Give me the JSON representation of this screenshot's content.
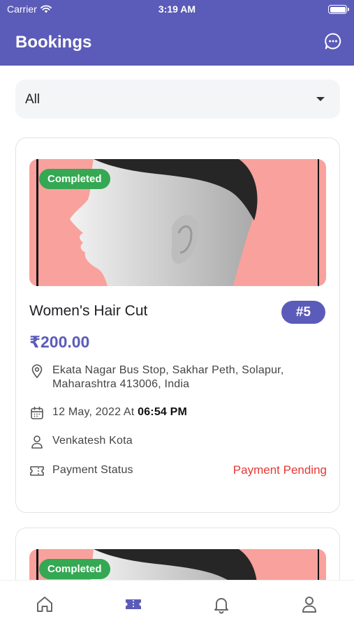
{
  "status_bar": {
    "carrier": "Carrier",
    "time": "3:19 AM"
  },
  "header": {
    "title": "Bookings",
    "chat_icon": "chat-bubble-icon"
  },
  "filter": {
    "selected": "All"
  },
  "bookings": [
    {
      "status": "Completed",
      "service": "Women's Hair Cut",
      "number": "#5",
      "price": "₹200.00",
      "address": "Ekata Nagar Bus Stop, Sakhar Peth, Solapur, Maharashtra 413006, India",
      "date": "12 May, 2022 At",
      "time": "06:54 PM",
      "customer": "Venkatesh Kota",
      "payment_label": "Payment Status",
      "payment_status": "Payment Pending"
    },
    {
      "status": "Completed"
    }
  ],
  "bottom_nav": [
    {
      "name": "home",
      "icon": "home-icon",
      "active": false
    },
    {
      "name": "bookings",
      "icon": "ticket-icon",
      "active": true
    },
    {
      "name": "notifications",
      "icon": "bell-icon",
      "active": false
    },
    {
      "name": "profile",
      "icon": "user-icon",
      "active": false
    }
  ],
  "colors": {
    "primary": "#5b5bb9",
    "completed": "#34a853",
    "pending": "#e53935",
    "image_bg": "#f9a19c"
  }
}
